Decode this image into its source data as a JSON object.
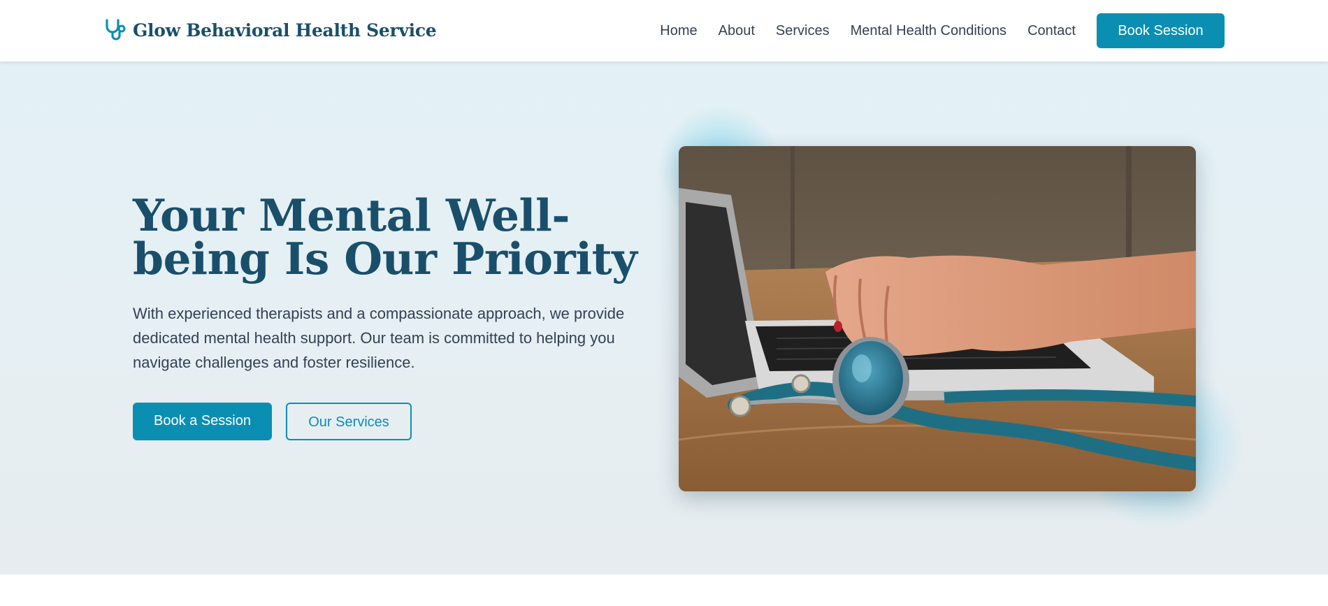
{
  "brand": {
    "name": "Glow Behavioral Health Service",
    "icon": "stethoscope-icon",
    "color": "#1a4f6b"
  },
  "nav": {
    "items": [
      {
        "label": "Home"
      },
      {
        "label": "About"
      },
      {
        "label": "Services"
      },
      {
        "label": "Mental Health Conditions"
      },
      {
        "label": "Contact"
      }
    ],
    "cta_label": "Book Session"
  },
  "hero": {
    "title": "Your Mental Well-being Is Our Priority",
    "description": "With experienced therapists and a compassionate approach, we provide dedicated mental health support. Our team is committed to helping you navigate challenges and foster resilience.",
    "primary_button": "Book a Session",
    "secondary_button": "Our Services",
    "image_subject": "hands-typing-on-laptop-with-stethoscope"
  },
  "colors": {
    "accent": "#0a8fb3",
    "heading": "#1a4f6b",
    "body_text": "#334155",
    "hero_background": "#e4f0f4"
  }
}
